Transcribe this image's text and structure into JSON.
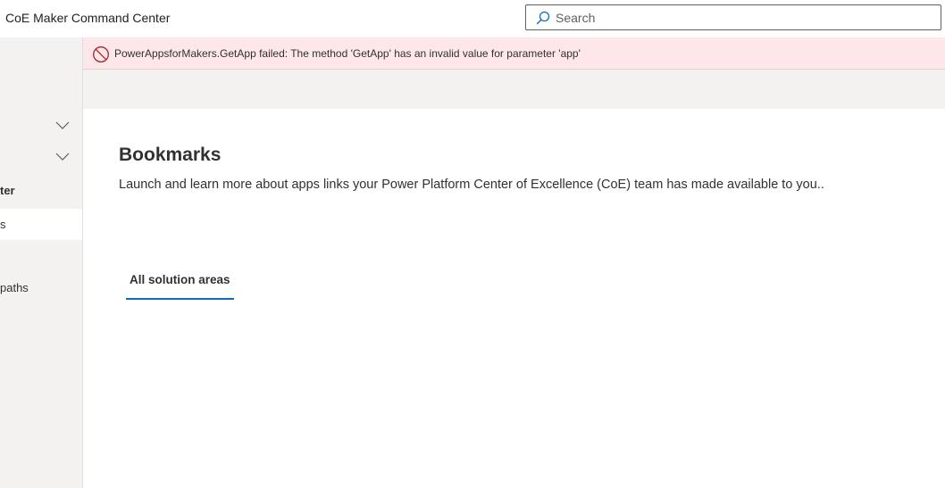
{
  "header": {
    "app_title": "CoE Maker Command Center",
    "search": {
      "placeholder": "Search",
      "value": ""
    }
  },
  "error_banner": {
    "icon": "blocked-icon",
    "message": "PowerAppsforMakers.GetApp failed: The method 'GetApp' has an invalid value for parameter 'app'",
    "color": "#fde7e9"
  },
  "sidebar": {
    "items": [
      {
        "label": "ter"
      },
      {
        "label": "s"
      },
      {
        "label": "paths"
      }
    ]
  },
  "main": {
    "title": "Bookmarks",
    "description": "Launch and learn more about apps links your Power Platform Center of Excellence (CoE) team has made available to you..",
    "tabs": [
      {
        "label": "All solution areas",
        "selected": true
      }
    ]
  },
  "colors": {
    "accent": "#0f6cbd",
    "sidebar_bg": "#f3f2f1",
    "error_icon": "#a4262c"
  }
}
